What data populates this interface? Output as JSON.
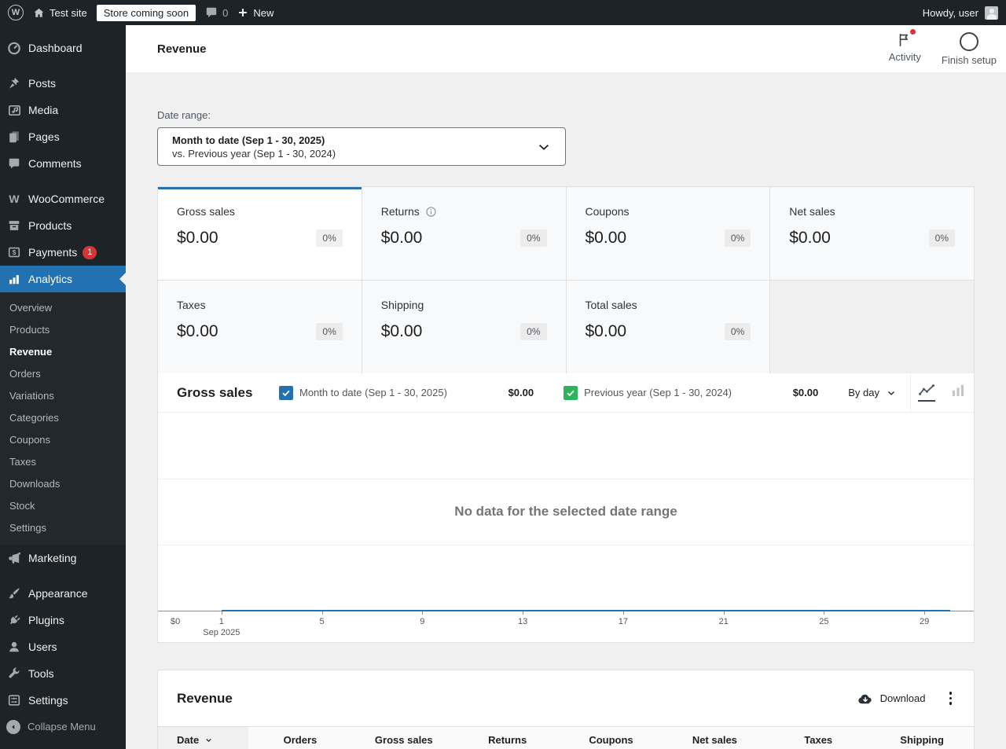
{
  "colors": {
    "accent_blue": "#2271b1",
    "series_green": "#2fb25c",
    "badge_red": "#d63638",
    "sidebar_bg": "#1d2327"
  },
  "admin_bar": {
    "wp_logo_icon": "wordpress-logo-icon",
    "home_icon": "home-icon",
    "site_name": "Test site",
    "coming_soon_badge": "Store coming soon",
    "comments_icon": "comment-bubble-icon",
    "comments_count": "0",
    "new_icon": "plus-icon",
    "new_label": "New",
    "howdy_text": "Howdy, user",
    "avatar_icon": "user-avatar"
  },
  "sidebar": {
    "items": [
      {
        "label": "Dashboard",
        "icon": "dashboard-icon"
      },
      {
        "label": "Posts",
        "icon": "pushpin-icon"
      },
      {
        "label": "Media",
        "icon": "media-icon"
      },
      {
        "label": "Pages",
        "icon": "pages-icon"
      },
      {
        "label": "Comments",
        "icon": "comment-icon"
      },
      {
        "label": "WooCommerce",
        "icon": "woocommerce-icon"
      },
      {
        "label": "Products",
        "icon": "box-icon"
      },
      {
        "label": "Payments",
        "icon": "dollar-box-icon",
        "badge": "1"
      },
      {
        "label": "Analytics",
        "icon": "bar-chart-icon",
        "active": true
      }
    ],
    "analytics_submenu": {
      "items": [
        "Overview",
        "Products",
        "Revenue",
        "Orders",
        "Variations",
        "Categories",
        "Coupons",
        "Taxes",
        "Downloads",
        "Stock",
        "Settings"
      ],
      "current": "Revenue"
    },
    "bottom_items": [
      {
        "label": "Marketing",
        "icon": "megaphone-icon"
      },
      {
        "label": "Appearance",
        "icon": "paintbrush-icon"
      },
      {
        "label": "Plugins",
        "icon": "plug-icon"
      },
      {
        "label": "Users",
        "icon": "user-icon"
      },
      {
        "label": "Tools",
        "icon": "wrench-icon"
      },
      {
        "label": "Settings",
        "icon": "sliders-icon"
      },
      {
        "label": "Collapse Menu",
        "icon": "collapse-arrow-icon"
      }
    ]
  },
  "header": {
    "title": "Revenue",
    "activity_label": "Activity",
    "finish_setup_label": "Finish setup"
  },
  "date_filter": {
    "label": "Date range:",
    "primary": "Month to date (Sep 1 - 30, 2025)",
    "secondary": "vs. Previous year (Sep 1 - 30, 2024)"
  },
  "summary_tiles": [
    {
      "label": "Gross sales",
      "value": "$0.00",
      "delta": "0%",
      "selected": true
    },
    {
      "label": "Returns",
      "value": "$0.00",
      "delta": "0%",
      "info": true
    },
    {
      "label": "Coupons",
      "value": "$0.00",
      "delta": "0%"
    },
    {
      "label": "Net sales",
      "value": "$0.00",
      "delta": "0%"
    },
    {
      "label": "Taxes",
      "value": "$0.00",
      "delta": "0%"
    },
    {
      "label": "Shipping",
      "value": "$0.00",
      "delta": "0%"
    },
    {
      "label": "Total sales",
      "value": "$0.00",
      "delta": "0%"
    }
  ],
  "chart": {
    "title": "Gross sales",
    "series": [
      {
        "label": "Month to date (Sep 1 - 30, 2025)",
        "total": "$0.00",
        "checked": true,
        "color": "#2271b1"
      },
      {
        "label": "Previous year (Sep 1 - 30, 2024)",
        "total": "$0.00",
        "checked": true,
        "color": "#2fb25c"
      }
    ],
    "interval": "By day",
    "empty_message": "No data for the selected date range",
    "y_zero": "$0",
    "x_ticks": [
      "1",
      "5",
      "9",
      "13",
      "17",
      "21",
      "25",
      "29"
    ],
    "x_month": "Sep 2025"
  },
  "chart_data": {
    "type": "line",
    "title": "Gross sales",
    "x_range": [
      1,
      30
    ],
    "x_ticks": [
      1,
      5,
      9,
      13,
      17,
      21,
      25,
      29
    ],
    "x_month_label": "Sep 2025",
    "y_tick_labels": [
      "$0"
    ],
    "series": [
      {
        "name": "Month to date (Sep 1 - 30, 2025)",
        "color": "#2271b1",
        "constant_value": 0
      },
      {
        "name": "Previous year (Sep 1 - 30, 2024)",
        "color": "#2fb25c",
        "constant_value": 0
      }
    ],
    "empty_message": "No data for the selected date range"
  },
  "table": {
    "title": "Revenue",
    "download_label": "Download",
    "sorted_column": "Date",
    "columns": [
      "Date",
      "Orders",
      "Gross sales",
      "Returns",
      "Coupons",
      "Net sales",
      "Taxes",
      "Shipping"
    ],
    "rows": []
  }
}
